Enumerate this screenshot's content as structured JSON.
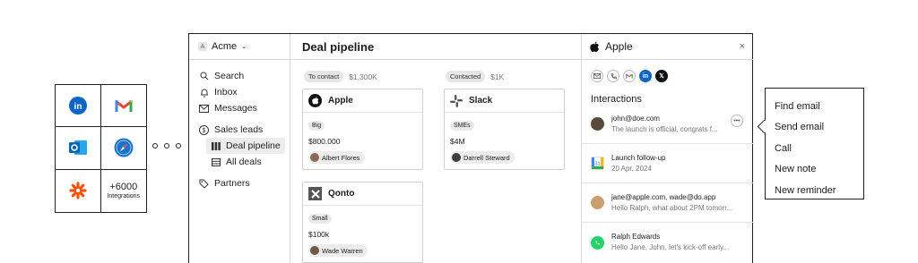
{
  "integrations": {
    "items": [
      "linkedin-icon",
      "gmail-icon",
      "outlook-icon",
      "safari-icon",
      "zapier-icon"
    ],
    "count_label": "+6000",
    "count_sub": "Integrations"
  },
  "workspace": {
    "name": "Acme",
    "badge": "A"
  },
  "sidebar": {
    "items": [
      {
        "label": "Search"
      },
      {
        "label": "Inbox"
      },
      {
        "label": "Messages"
      },
      {
        "label": "Sales leads"
      },
      {
        "label": "Deal pipeline"
      },
      {
        "label": "All deals"
      },
      {
        "label": "Partners"
      }
    ]
  },
  "main": {
    "title": "Deal pipeline",
    "columns": [
      {
        "stage": "To contact",
        "total": "$1,300K",
        "cards": [
          {
            "company": "Apple",
            "tag": "Big",
            "amount": "$800.000",
            "owner": "Albert Flores"
          },
          {
            "company": "Qonto",
            "tag": "Small",
            "amount": "$100k",
            "owner": "Wade Warren"
          }
        ]
      },
      {
        "stage": "Contacted",
        "total": "$1K",
        "cards": [
          {
            "company": "Slack",
            "tag": "SMEs",
            "amount": "$4M",
            "owner": "Darrell Steward"
          }
        ]
      }
    ]
  },
  "panel": {
    "title": "Apple",
    "close": "×",
    "section": "Interactions",
    "interactions": [
      {
        "line1": "john@doe.com",
        "line2": "The launch is official, congrats f..."
      },
      {
        "line1": "Launch follow-up",
        "line2": "20 Apr, 2024"
      },
      {
        "line1": "jane@apple.com, wade@do.app",
        "line2": "Hello Ralph, what about 2PM tomorr..."
      },
      {
        "line1": "Ralph Edwards",
        "line2": "Hello Jane, John, let's kick-off early..."
      }
    ]
  },
  "menu": {
    "items": [
      "Find email",
      "Send email",
      "Call",
      "New note",
      "New reminder"
    ]
  },
  "colors": {
    "linkedin": "#0a66c2",
    "outlook": "#0364b8",
    "safari": "#1b74c8",
    "zapier": "#ff4f00",
    "whatsapp": "#25d366"
  }
}
